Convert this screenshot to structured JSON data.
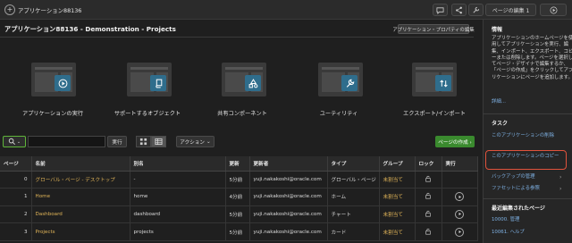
{
  "topbar": {
    "app_title": "アプリケーション88136",
    "edit_page_label": "ページの編集 1"
  },
  "header": {
    "page_title": "アプリケーション88136 - Demonstration - Projects",
    "app_properties_label": "アプリケーション・プロパティの編集"
  },
  "tiles": [
    {
      "label": "アプリケーションの実行",
      "icon": "play-icon"
    },
    {
      "label": "サポートするオブジェクト",
      "icon": "scroll-icon"
    },
    {
      "label": "共有コンポーネント",
      "icon": "shapes-icon"
    },
    {
      "label": "ユーティリティ",
      "icon": "wrench-icon"
    },
    {
      "label": "エクスポート/インポート",
      "icon": "import-export-icon"
    }
  ],
  "toolbar": {
    "execute_label": "実行",
    "actions_label": "アクション",
    "create_page_label": "ページの作成 ›"
  },
  "table": {
    "columns": [
      "ページ",
      "名前",
      "別名",
      "更新",
      "更新者",
      "タイプ",
      "グループ",
      "ロック",
      "実行"
    ],
    "rows": [
      {
        "page": "0",
        "name": "グローバル・ページ - デスクトップ",
        "alias": "-",
        "updated": "5分前",
        "updated_by": "yuji.nakakoshi@oracle.com",
        "type": "グローバル・ページ",
        "group": "未割当て",
        "lock": true,
        "run": false
      },
      {
        "page": "1",
        "name": "Home",
        "alias": "home",
        "updated": "4分前",
        "updated_by": "yuji.nakakoshi@oracle.com",
        "type": "ホーム",
        "group": "未割当て",
        "lock": true,
        "run": true
      },
      {
        "page": "2",
        "name": "Dashboard",
        "alias": "dashboard",
        "updated": "5分前",
        "updated_by": "yuji.nakakoshi@oracle.com",
        "type": "チャート",
        "group": "未割当て",
        "lock": true,
        "run": true
      },
      {
        "page": "3",
        "name": "Projects",
        "alias": "projects",
        "updated": "5分前",
        "updated_by": "yuji.nakakoshi@oracle.com",
        "type": "カード",
        "group": "未割当て",
        "lock": true,
        "run": true
      }
    ]
  },
  "side": {
    "info_heading": "情報",
    "info_text": "アプリケーションのホームページを使用してアプリケーションを実行、編集、インポート、エクスポート、コピーまたは削除します。ページを選択してページ・デザイナで編集するか、「ページの作成」をクリックしてアプリケーションにページを追加します。",
    "detail_link": "詳細...",
    "tasks_heading": "タスク",
    "task_delete": "このアプリケーションの削除",
    "task_copy": "このアプリケーションのコピー",
    "task_backup": "バックアップの管理",
    "task_checkpoint": "ファセットによる参照",
    "recent_heading": "最近編集されたページ",
    "recent_1": "10000. 管理",
    "recent_2": "10061. ヘルプ"
  },
  "colors": {
    "accent_green": "#3a8a2e",
    "link_blue": "#7fb2e5",
    "highlight_red": "#e0533c",
    "badge_blue": "#2f6d8c"
  }
}
